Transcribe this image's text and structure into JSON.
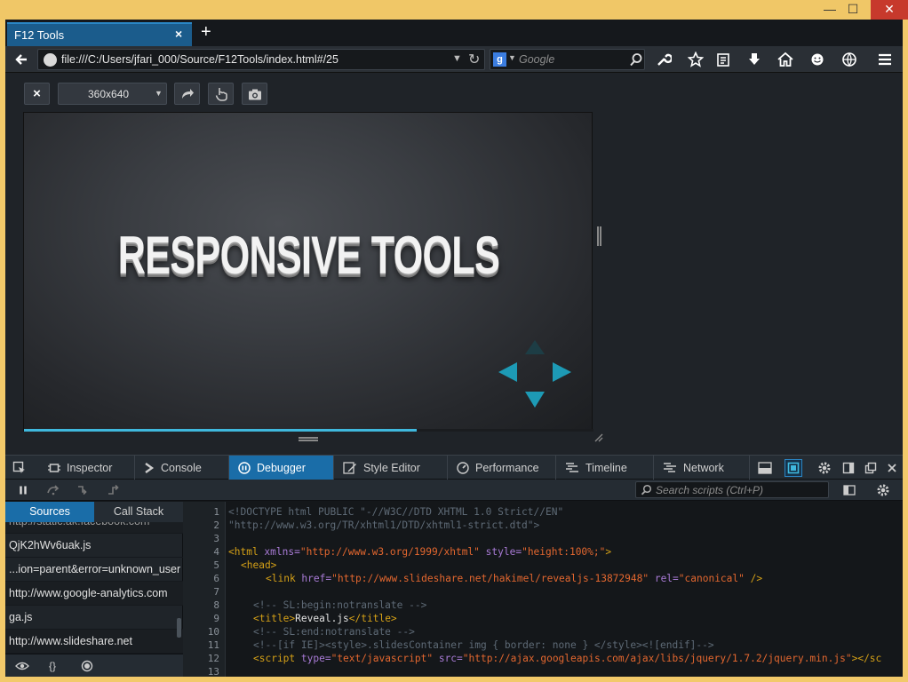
{
  "window": {
    "minimize_glyph": "—",
    "maximize_glyph": "☐",
    "close_glyph": "✕"
  },
  "browser": {
    "tab_title": "F12 Tools",
    "tab_close_glyph": "×",
    "new_tab_glyph": "+",
    "url": "file:///C:/Users/jfari_000/Source/F12Tools/index.html#/25",
    "search_placeholder": "Google",
    "search_engine_letter": "g"
  },
  "responsive": {
    "close_glyph": "×",
    "preset": "360x640",
    "slide_title": "RESPONSIVE TOOLS",
    "progress_fraction": 0.69,
    "accent": "#3fb8dd",
    "nav_color": "#1d9ab5"
  },
  "devtools": {
    "tabs": [
      {
        "label": "Inspector",
        "icon": "box-icon"
      },
      {
        "label": "Console",
        "icon": "prompt-icon"
      },
      {
        "label": "Debugger",
        "icon": "pause-circle-icon",
        "active": true
      },
      {
        "label": "Style Editor",
        "icon": "pencil-icon"
      },
      {
        "label": "Performance",
        "icon": "gauge-icon"
      },
      {
        "label": "Timeline",
        "icon": "timeline-icon"
      },
      {
        "label": "Network",
        "icon": "network-icon"
      }
    ],
    "search_placeholder": "Search scripts (Ctrl+P)",
    "sources_tab": "Sources",
    "callstack_tab": "Call Stack",
    "sources": [
      "http://static.ak.facebook.com",
      "QjK2hWv6uak.js",
      "...ion=parent&error=unknown_user",
      "http://www.google-analytics.com",
      "ga.js",
      "http://www.slideshare.net"
    ],
    "footer_braces": "{}",
    "line_numbers": [
      "1",
      "2",
      "3",
      "4",
      "5",
      "6",
      "7",
      "8",
      "9",
      "10",
      "11",
      "12",
      "13"
    ],
    "code": {
      "l1": "<!DOCTYPE html PUBLIC \"-//W3C//DTD XHTML 1.0 Strict//EN\"",
      "l2": "\"http://www.w3.org/TR/xhtml1/DTD/xhtml1-strict.dtd\">",
      "l4_open": "<html",
      "l4_attr1": " xmlns=",
      "l4_val1": "\"http://www.w3.org/1999/xhtml\"",
      "l4_attr2": " style=",
      "l4_val2": "\"height:100%;\"",
      "l4_close": ">",
      "l5": "<head>",
      "l6_open": "<link",
      "l6_attr1": " href=",
      "l6_val1": "\"http://www.slideshare.net/hakimel/revealjs-13872948\"",
      "l6_attr2": " rel=",
      "l6_val2": "\"canonical\"",
      "l6_close": " />",
      "l8": "<!-- SL:begin:notranslate -->",
      "l9_open": "<title>",
      "l9_text": "Reveal.js",
      "l9_close": "</title>",
      "l10": "<!-- SL:end:notranslate -->",
      "l11": "<!--[if IE]><style>.slidesContainer img { border: none } </style><![endif]-->",
      "l12_open": "<script",
      "l12_attr1": " type=",
      "l12_val1": "\"text/javascript\"",
      "l12_attr2": " src=",
      "l12_val2": "\"http://ajax.googleapis.com/ajax/libs/jquery/1.7.2/jquery.min.js\"",
      "l12_close": "></sc"
    }
  }
}
